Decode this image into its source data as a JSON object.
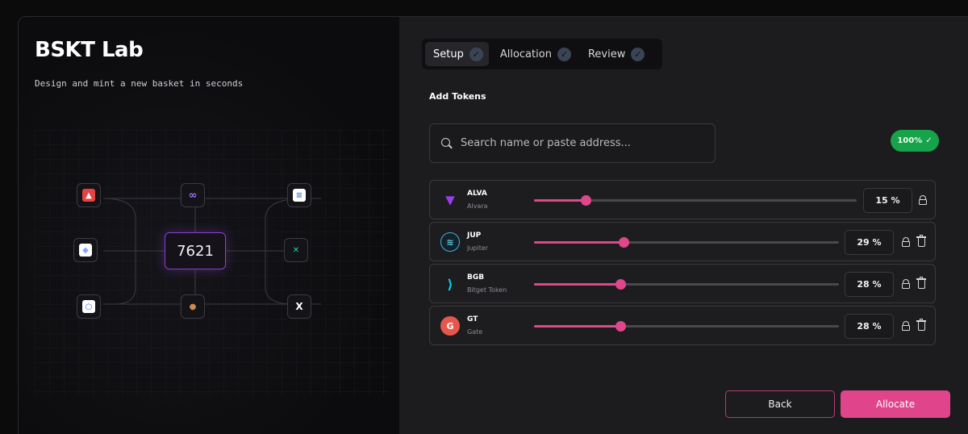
{
  "app": {
    "title": "BSKT Lab",
    "subtitle": "Design and mint a new basket in seconds"
  },
  "diagram": {
    "center_value": "7621",
    "nodes": [
      {
        "name": "avalanche-icon",
        "color": "#e84142",
        "glyph": "▲"
      },
      {
        "name": "polygon-icon",
        "color": "#8247e5",
        "glyph": "∞"
      },
      {
        "name": "document-icon",
        "color": "#ffffff",
        "glyph": "≡"
      },
      {
        "name": "ethereum-icon",
        "color": "#c9d4ff",
        "glyph": "◆"
      },
      {
        "name": "x-token-icon",
        "color": "#1dd6b0",
        "glyph": "✕"
      },
      {
        "name": "ring-icon",
        "color": "#ffffff",
        "glyph": "○"
      },
      {
        "name": "pancake-icon",
        "color": "#d1884f",
        "glyph": "●"
      },
      {
        "name": "x-logo-icon",
        "color": "#ffffff",
        "glyph": "X"
      }
    ]
  },
  "stepper": {
    "steps": [
      {
        "label": "Setup",
        "active": true
      },
      {
        "label": "Allocation",
        "active": false
      },
      {
        "label": "Review",
        "active": false
      }
    ]
  },
  "tokens_section": {
    "label": "Add Tokens",
    "search_placeholder": "Search name or paste address...",
    "total_badge": "100%"
  },
  "tokens": [
    {
      "symbol": "ALVA",
      "name": "Alvara",
      "percent": 15,
      "percent_label": "15 %",
      "locked": true,
      "deletable": false,
      "logo_color": "#9b3cf0"
    },
    {
      "symbol": "JUP",
      "name": "Jupiter",
      "percent": 29,
      "percent_label": "29 %",
      "locked": false,
      "deletable": true,
      "logo_color": "#1b2a3a"
    },
    {
      "symbol": "BGB",
      "name": "Bitget Token",
      "percent": 28,
      "percent_label": "28 %",
      "locked": false,
      "deletable": true,
      "logo_color": "#00d8e8"
    },
    {
      "symbol": "GT",
      "name": "Gate",
      "percent": 28,
      "percent_label": "28 %",
      "locked": false,
      "deletable": true,
      "logo_color": "#e5574d"
    }
  ],
  "actions": {
    "back_label": "Back",
    "allocate_label": "Allocate"
  },
  "colors": {
    "accent": "#e0458b",
    "success": "#16a34a",
    "diagram_accent": "#8a3fd0"
  }
}
